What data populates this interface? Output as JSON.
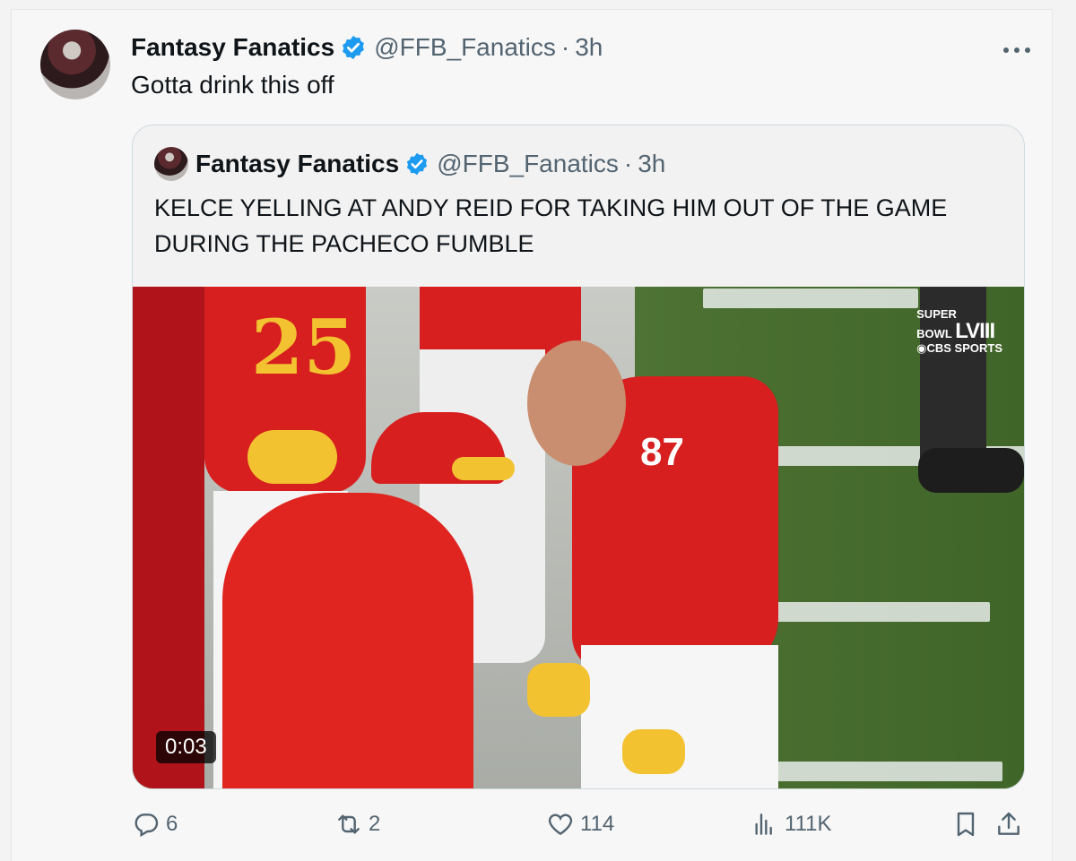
{
  "tweet": {
    "author_name": "Fantasy Fanatics",
    "handle": "@FFB_Fanatics",
    "separator": "·",
    "time": "3h",
    "text": "Gotta drink this off"
  },
  "quoted": {
    "author_name": "Fantasy Fanatics",
    "handle": "@FFB_Fanatics",
    "separator": "·",
    "time": "3h",
    "text": "KELCE YELLING AT ANDY REID FOR TAKING HIM OUT OF THE GAME DURING THE PACHECO FUMBLE",
    "video": {
      "timer": "0:03",
      "broadcast_logo_top": "SUPER",
      "broadcast_logo_mid": "BOWL",
      "broadcast_logo_numeral": "LVIII",
      "broadcast_network": "CBS SPORTS",
      "jersey_numbers": [
        "25",
        "87"
      ]
    }
  },
  "actions": {
    "replies": "6",
    "reposts": "2",
    "likes": "114",
    "views": "111K"
  },
  "colors": {
    "verified": "#1d9bf0",
    "muted_text": "#536471",
    "chiefs_red": "#d71f1f",
    "chiefs_gold": "#f2c230"
  },
  "icons": [
    "verified-badge-icon",
    "reply-icon",
    "repost-icon",
    "like-icon",
    "views-icon",
    "bookmark-icon",
    "share-icon"
  ]
}
